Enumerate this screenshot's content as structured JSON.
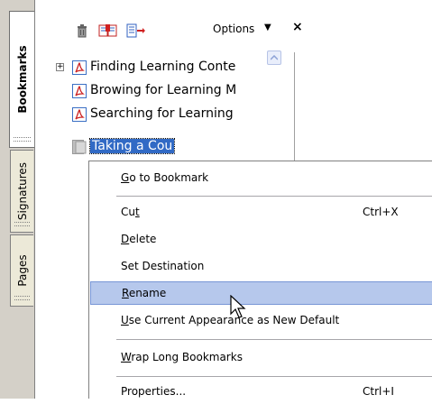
{
  "tabs": [
    {
      "label": "Bookmarks",
      "active": true
    },
    {
      "label": "Signatures",
      "active": false
    },
    {
      "label": "Pages",
      "active": false
    }
  ],
  "toolbar": {
    "options_label": "Options",
    "close_symbol": "×",
    "icons": [
      "delete-bookmark-icon",
      "new-bookmark-icon",
      "bookmark-properties-icon",
      "options-dropdown-arrow-icon"
    ]
  },
  "bookmarks": [
    {
      "label": "Finding Learning Conte",
      "expandable": true,
      "expand_symbol": "+",
      "selected": false
    },
    {
      "label": "Browing for Learning M",
      "expandable": false,
      "selected": false
    },
    {
      "label": "Searching for Learning",
      "expandable": false,
      "selected": false
    },
    {
      "label": "Taking a Cou",
      "expandable": false,
      "selected": true
    }
  ],
  "context_menu": {
    "items": [
      {
        "label": "Go to Bookmark",
        "mnemonic": "G",
        "shortcut": "",
        "highlighted": false
      },
      {
        "label": "Cut",
        "mnemonic": "t",
        "shortcut": "Ctrl+X",
        "highlighted": false
      },
      {
        "label": "Delete",
        "mnemonic": "D",
        "shortcut": "",
        "highlighted": false
      },
      {
        "label": "Set Destination",
        "mnemonic": "",
        "shortcut": "",
        "highlighted": false
      },
      {
        "label": "Rename",
        "mnemonic": "R",
        "shortcut": "",
        "highlighted": true
      },
      {
        "label": "Use Current Appearance as New Default",
        "mnemonic": "U",
        "shortcut": "",
        "highlighted": false
      },
      {
        "label": "Wrap Long Bookmarks",
        "mnemonic": "W",
        "shortcut": "",
        "highlighted": false
      },
      {
        "label": "Properties...",
        "mnemonic": "",
        "shortcut": "Ctrl+I",
        "highlighted": false
      }
    ]
  },
  "colors": {
    "selection": "#316ac5",
    "menu_highlight": "#b6c8ec",
    "frame": "#d4d0c8",
    "pdf_icon_red": "#cc2222"
  }
}
